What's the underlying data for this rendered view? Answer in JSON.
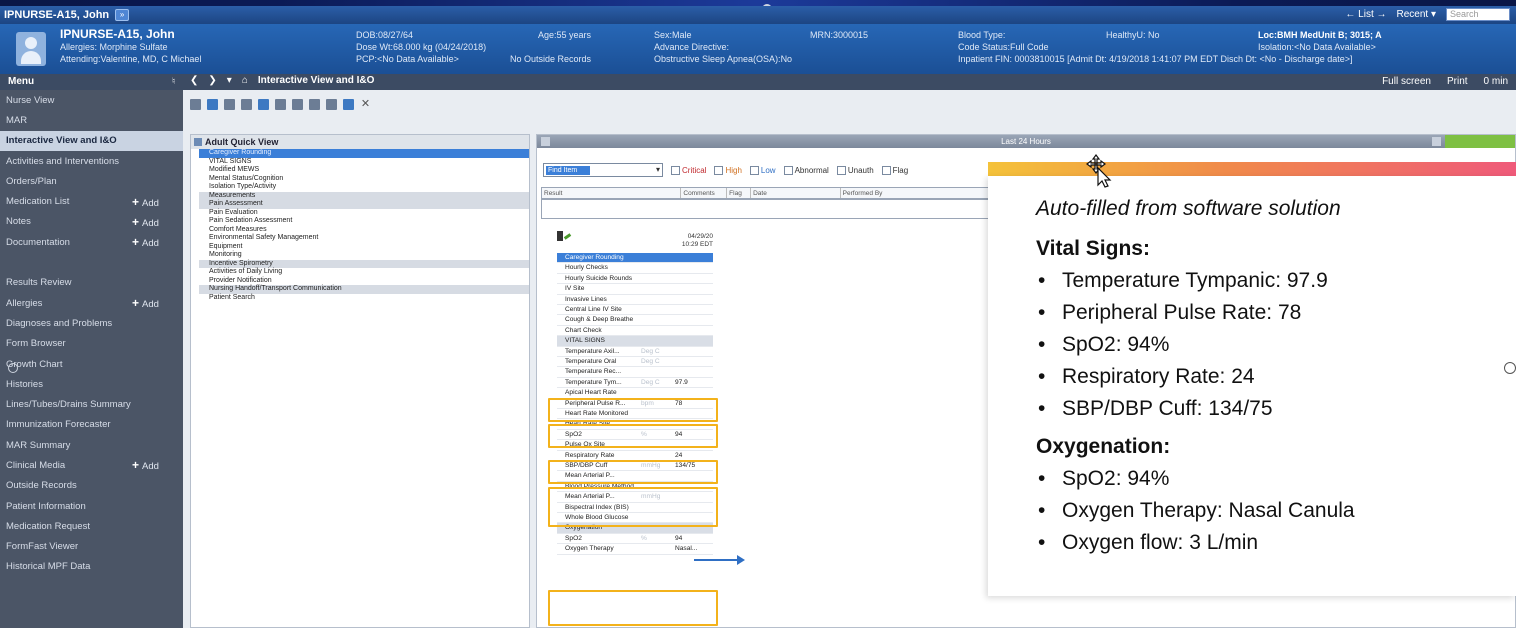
{
  "window": {
    "title": "IPNURSE-A15, John",
    "title_btn": "»",
    "list_label": "← List →",
    "recent_label": "Recent ▾",
    "search_placeholder": "Search"
  },
  "banner": {
    "patient_name": "IPNURSE-A15, John",
    "allergies": "Allergies: Morphine Sulfate",
    "attending": "Attending:Valentine, MD, C Michael",
    "dob": "DOB:08/27/64",
    "dose_wt": "Dose Wt:68.000 kg (04/24/2018)",
    "pcp": "PCP:<No Data Available>",
    "age": "Age:55 years",
    "outside_records": "No Outside Records",
    "sex": "Sex:Male",
    "advance_directive": "Advance Directive:",
    "osa": "Obstructive Sleep Apnea(OSA):No",
    "mrn": "MRN:3000015",
    "blood_type": "Blood Type:",
    "code_status": "Code Status:Full Code",
    "inpatient": "Inpatient FIN: 0003810015 [Admit Dt: 4/19/2018 1:41:07 PM EDT Disch Dt: <No - Discharge date>]",
    "healthyu": "HealthyU: No",
    "location": "Loc:BMH MedUnit B; 3015; A",
    "isolation": "Isolation:<No Data Available>"
  },
  "menubar": {
    "menu_label": "Menu",
    "view_title": "Interactive View and I&O",
    "full_screen": "Full screen",
    "print": "Print",
    "refresh": "0 min"
  },
  "sidebar": {
    "items": [
      {
        "label": "Nurse View"
      },
      {
        "label": "MAR"
      },
      {
        "label": "Interactive View and I&O",
        "active": true
      },
      {
        "label": "Activities and Interventions"
      },
      {
        "label": "Orders/Plan"
      },
      {
        "label": "Medication List",
        "add": "Add"
      },
      {
        "label": "Notes",
        "add": "Add"
      },
      {
        "label": "Documentation",
        "add": "Add"
      },
      {
        "label": ""
      },
      {
        "label": "Results Review"
      },
      {
        "label": "Allergies",
        "add": "Add"
      },
      {
        "label": "Diagnoses and Problems"
      },
      {
        "label": "Form Browser"
      },
      {
        "label": "Growth Chart"
      },
      {
        "label": "Histories"
      },
      {
        "label": "Lines/Tubes/Drains Summary"
      },
      {
        "label": "Immunization Forecaster"
      },
      {
        "label": "MAR Summary"
      },
      {
        "label": "Clinical Media",
        "add": "Add"
      },
      {
        "label": "Outside Records"
      },
      {
        "label": "Patient Information"
      },
      {
        "label": "Medication Request"
      },
      {
        "label": "FormFast Viewer"
      },
      {
        "label": "Historical MPF Data"
      }
    ]
  },
  "quick_view": {
    "title": "Adult Quick View",
    "items": [
      {
        "label": "Caregiver Rounding",
        "state": "sel"
      },
      {
        "label": "VITAL SIGNS"
      },
      {
        "label": "Modified MEWS"
      },
      {
        "label": "Mental Status/Cognition"
      },
      {
        "label": "Isolation Type/Activity"
      },
      {
        "label": "Measurements",
        "state": "grp"
      },
      {
        "label": "Pain Assessment",
        "state": "grp"
      },
      {
        "label": "Pain Evaluation"
      },
      {
        "label": "Pain Sedation Assessment"
      },
      {
        "label": "Comfort Measures"
      },
      {
        "label": "Environmental Safety Management"
      },
      {
        "label": "Equipment"
      },
      {
        "label": "Monitoring"
      },
      {
        "label": "Incentive Spirometry",
        "state": "grp"
      },
      {
        "label": "Activities of Daily Living"
      },
      {
        "label": "Provider Notification"
      },
      {
        "label": "Nursing Handoff/Transport Communication",
        "state": "grp"
      },
      {
        "label": "Patient Search"
      }
    ]
  },
  "flowsheet": {
    "time_range": "Last 24 Hours",
    "find_item": "Find Item",
    "filters": [
      "Critical",
      "High",
      "Low",
      "Abnormal",
      "Unauth",
      "Flag"
    ],
    "result_columns": [
      "Result",
      "Comments",
      "Flag",
      "Date",
      "Performed By"
    ],
    "date_col": "04/29/20",
    "time_col": "10:29 EDT",
    "rows": [
      {
        "label": "Caregiver Rounding",
        "type": "hdr"
      },
      {
        "label": "Hourly Checks"
      },
      {
        "label": "Hourly Suicide Rounds"
      },
      {
        "label": "IV Site"
      },
      {
        "label": "Invasive Lines"
      },
      {
        "label": "Central Line IV Site"
      },
      {
        "label": "Cough & Deep Breathe"
      },
      {
        "label": "Chart Check"
      },
      {
        "label": "VITAL SIGNS",
        "type": "sub"
      },
      {
        "label": "Temperature Axil...",
        "unit": "Deg C"
      },
      {
        "label": "Temperature Oral",
        "unit": "Deg C"
      },
      {
        "label": "Temperature Rec...",
        "unit": ""
      },
      {
        "label": "Temperature Tym...",
        "unit": "Deg C",
        "value": "97.9"
      },
      {
        "label": "Apical Heart Rate"
      },
      {
        "label": "Peripheral Pulse R...",
        "unit": "bpm",
        "value": "78"
      },
      {
        "label": "Heart Rate Monitored"
      },
      {
        "label": "Heart Rate Site"
      },
      {
        "label": "SpO2",
        "unit": "%",
        "value": "94"
      },
      {
        "label": "Pulse Ox Site"
      },
      {
        "label": "Respiratory Rate",
        "value": "24"
      },
      {
        "label": "SBP/DBP Cuff",
        "unit": "mmHg",
        "value": "134/75"
      },
      {
        "label": "Mean Arterial P...",
        "unit": ""
      },
      {
        "label": "Blood Pressure Method"
      },
      {
        "label": "Mean Arterial P...",
        "unit": "mmHg"
      },
      {
        "label": "Bispectral Index (BIS)"
      },
      {
        "label": "Whole Blood Glucose"
      },
      {
        "label": "Oxygenation",
        "type": "sub"
      },
      {
        "label": "SpO2",
        "unit": "%",
        "value": "94"
      },
      {
        "label": "Oxygen Therapy",
        "value": "Nasal..."
      }
    ]
  },
  "callout": {
    "subtitle": "Auto-filled from software solution",
    "vitals_heading": "Vital Signs:",
    "vitals": [
      "Temperature Tympanic: 97.9",
      "Peripheral Pulse Rate: 78",
      "SpO2: 94%",
      "Respiratory Rate: 24",
      "SBP/DBP Cuff: 134/75"
    ],
    "oxy_heading": "Oxygenation:",
    "oxy": [
      "SpO2: 94%",
      "Oxygen Therapy: Nasal Canula",
      "Oxygen flow: 3 L/min"
    ]
  },
  "colors": {
    "highlight": "#f3b21b",
    "banner": "#1f57a3",
    "sidebar": "#4b5566"
  }
}
